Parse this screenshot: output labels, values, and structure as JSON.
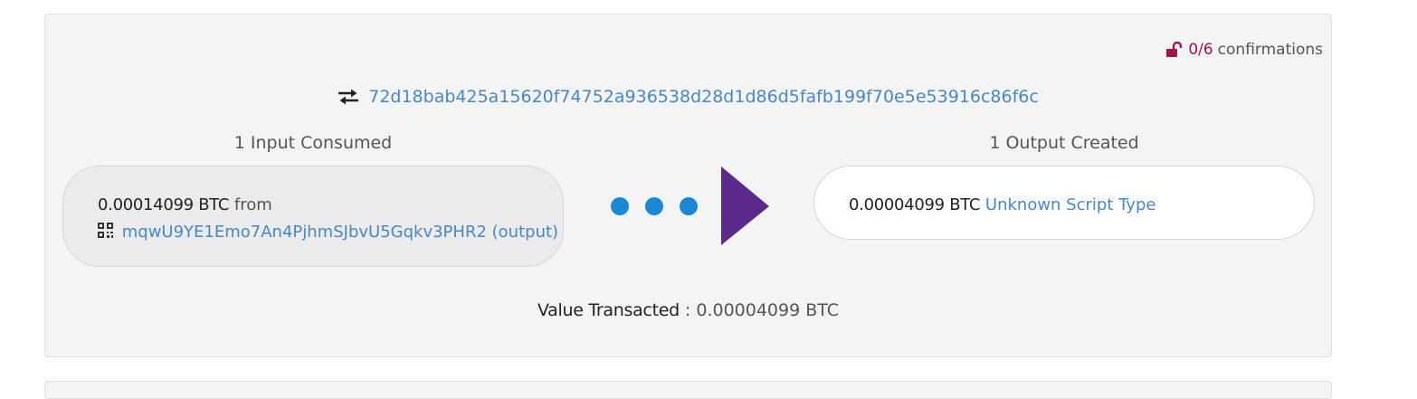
{
  "confirmations": {
    "count": "0/6",
    "label": "confirmations",
    "icon": "unlock-icon",
    "color": "#a0144c"
  },
  "transaction": {
    "icon": "exchange-arrows-icon",
    "txid": "72d18bab425a15620f74752a936538d28d1d86d5fafb199f70e5e53916c86f6c"
  },
  "inputs": {
    "title": "1 Input Consumed",
    "items": [
      {
        "amount": "0.00014099 BTC",
        "from_label": "from",
        "address_icon": "qrcode-icon",
        "address": "mqwU9YE1Emo7An4PjhmSJbvU5Gqkv3PHR2",
        "output_link": "(output)"
      }
    ]
  },
  "flow": {
    "dots_color": "#1b88d6",
    "arrow_color": "#5b2a8a"
  },
  "outputs": {
    "title": "1 Output Created",
    "items": [
      {
        "amount": "0.00004099 BTC",
        "script_type": "Unknown Script Type"
      }
    ]
  },
  "summary": {
    "label": "Value Transacted",
    "separator": " : ",
    "value": "0.00004099 BTC"
  },
  "colors": {
    "link": "#4a86c0",
    "card_bg": "#f4f4f4"
  }
}
